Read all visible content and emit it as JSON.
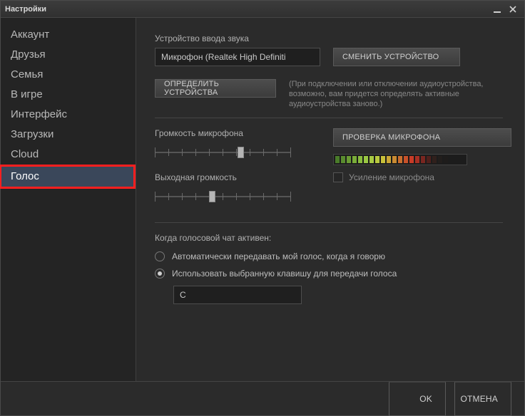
{
  "window": {
    "title": "Настройки"
  },
  "sidebar": {
    "items": [
      {
        "label": "Аккаунт"
      },
      {
        "label": "Друзья"
      },
      {
        "label": "Семья"
      },
      {
        "label": "В игре"
      },
      {
        "label": "Интерфейс"
      },
      {
        "label": "Загрузки"
      },
      {
        "label": "Cloud"
      },
      {
        "label": "Голос"
      }
    ],
    "selected_index": 7
  },
  "voice": {
    "input_section_label": "Устройство ввода звука",
    "input_device": "Микрофон (Realtek High Definiti",
    "change_device_btn": "СМЕНИТЬ УСТРОЙСТВО",
    "detect_devices_btn": "ОПРЕДЕЛИТЬ УСТРОЙСТВА",
    "detect_hint": "(При подключении или отключении аудиоустройства, возможно, вам придется определять активные аудиоустройства заново.)",
    "mic_volume_label": "Громкость микрофона",
    "output_volume_label": "Выходная громкость",
    "test_mic_btn": "ПРОВЕРКА МИКРОФОНА",
    "boost_label": "Усиление микрофона",
    "voice_chat_active_label": "Когда голосовой чат активен:",
    "radio_auto": "Автоматически передавать мой голос, когда я говорю",
    "radio_ptt": "Использовать выбранную клавишу для передачи голоса",
    "ptt_key": "C",
    "mic_slider_pos": 0.63,
    "out_slider_pos": 0.42
  },
  "footer": {
    "ok": "OK",
    "cancel": "ОТМЕНА"
  },
  "meter_colors": [
    "#4a7c2a",
    "#5a8c2f",
    "#6a9c34",
    "#7aac39",
    "#8abc3e",
    "#9ac843",
    "#a8ca44",
    "#b9c93f",
    "#c8c03a",
    "#caa636",
    "#c98a32",
    "#c96e2e",
    "#c8522a",
    "#c83b27",
    "#a83024",
    "#7a2620",
    "#50201c",
    "#30201c",
    "#221e1c",
    "#1e1c1b"
  ]
}
